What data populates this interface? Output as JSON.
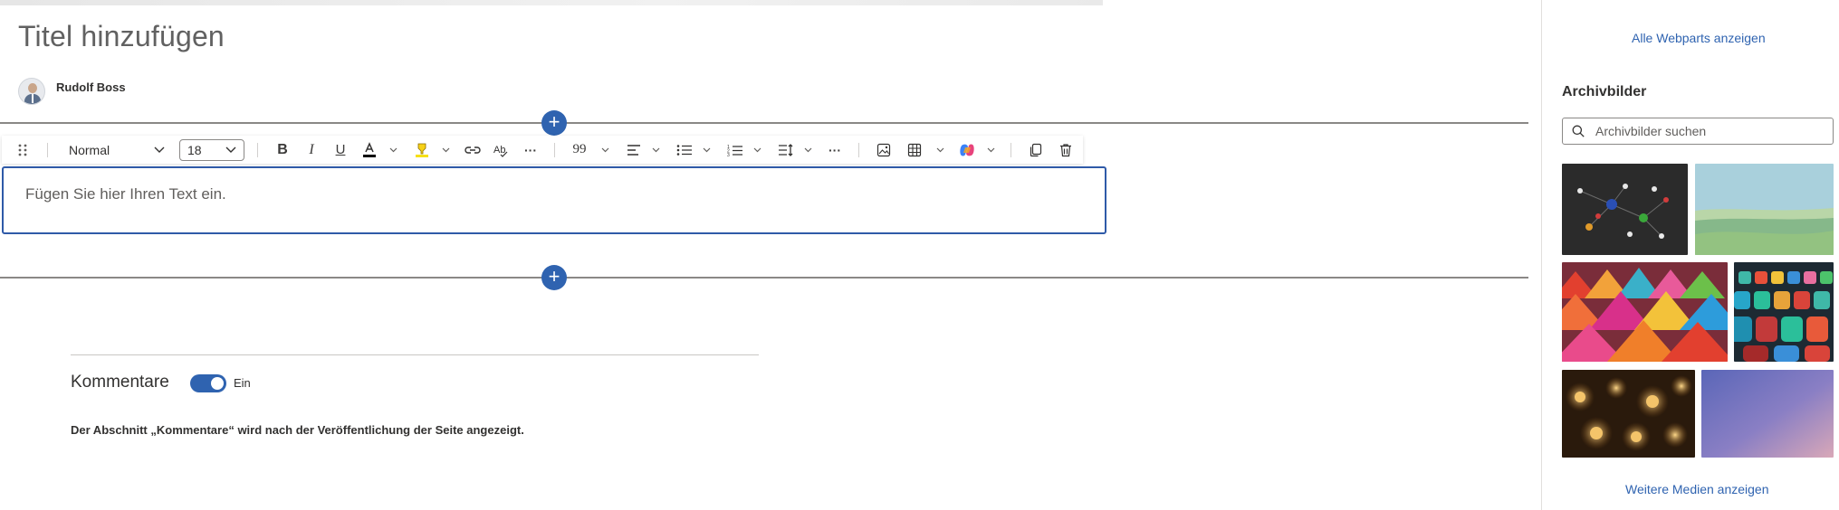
{
  "page": {
    "title": "Titel hinzufügen",
    "author": "Rudolf Boss"
  },
  "toolbar": {
    "style_value": "Normal",
    "font_size_value": "18",
    "more_label": "···"
  },
  "editor": {
    "placeholder": "Fügen Sie hier Ihren Text ein."
  },
  "comments": {
    "title": "Kommentare",
    "toggle_state": "Ein",
    "note": "Der Abschnitt „Kommentare“ wird nach der Veröffentlichung der Seite angezeigt."
  },
  "pane": {
    "all_webparts_link": "Alle Webparts anzeigen",
    "heading": "Archivbilder",
    "search_placeholder": "Archivbilder suchen",
    "more_media_link": "Weitere Medien anzeigen"
  },
  "colors": {
    "accent": "#2f63b0",
    "editor_border": "#2f5aa8",
    "divider": "#8a8886"
  },
  "icons": {
    "plus": "+",
    "quote": "99"
  }
}
